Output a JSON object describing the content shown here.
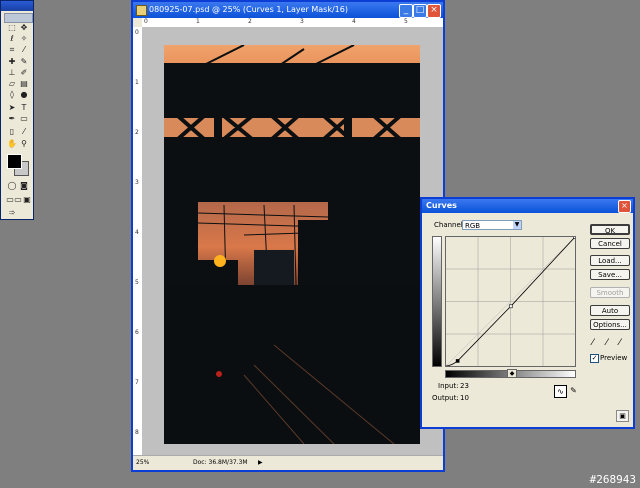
{
  "document": {
    "title": "080925-07.psd @ 25% (Curves 1, Layer Mask/16)",
    "zoom": "25%",
    "doc_info": "Doc: 36.8M/37.3M",
    "ruler_top": [
      "0",
      "1",
      "2",
      "3",
      "4",
      "5",
      "6"
    ],
    "ruler_left": [
      "0",
      "1",
      "2",
      "3",
      "4",
      "5",
      "6",
      "7",
      "8"
    ]
  },
  "curves": {
    "title": "Curves",
    "channel_label": "Channel:",
    "channel_value": "RGB",
    "input_label": "Input:",
    "input_value": "23",
    "output_label": "Output:",
    "output_value": "10",
    "buttons": {
      "ok": "OK",
      "cancel": "Cancel",
      "load": "Load...",
      "save": "Save...",
      "smooth": "Smooth",
      "auto": "Auto",
      "options": "Options..."
    },
    "preview_label": "Preview",
    "preview_checked": true,
    "curve_points": [
      [
        23,
        10
      ],
      [
        128,
        118
      ],
      [
        255,
        255
      ]
    ]
  },
  "watermark": "#268943",
  "colors": {
    "title_bar": "#0a52d8",
    "sky_orange": "#f0a26a",
    "sun": "#ffb21e"
  }
}
